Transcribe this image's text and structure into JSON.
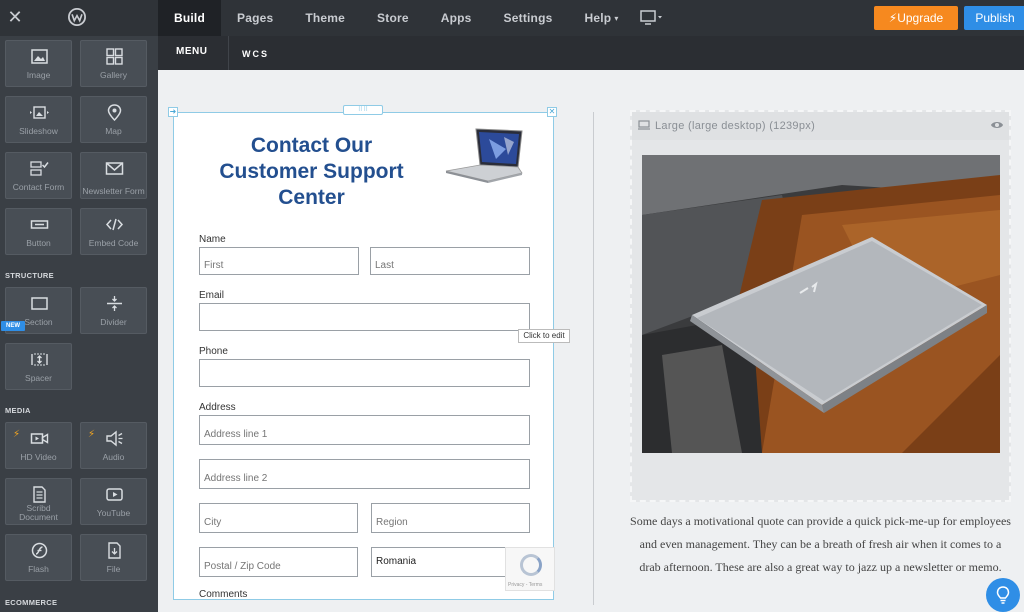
{
  "topbar": {
    "close_icon": "close-icon",
    "logo_icon": "weebly-logo-icon",
    "tabs": [
      "Build",
      "Pages",
      "Theme",
      "Store",
      "Apps",
      "Settings",
      "Help"
    ],
    "active_tab": "Build",
    "help_caret": "▾",
    "device_icon": "monitor-icon",
    "upgrade_label": "Upgrade",
    "publish_label": "Publish",
    "colors": {
      "upgrade": "#f6891f",
      "publish": "#2f8ee6"
    }
  },
  "sidebar": {
    "elements": [
      {
        "label": "Image",
        "icon": "image-icon"
      },
      {
        "label": "Gallery",
        "icon": "gallery-icon"
      },
      {
        "label": "Slideshow",
        "icon": "slideshow-icon"
      },
      {
        "label": "Map",
        "icon": "map-pin-icon"
      },
      {
        "label": "Contact Form",
        "icon": "contact-form-icon"
      },
      {
        "label": "Newsletter Form",
        "icon": "envelope-icon"
      },
      {
        "label": "Button",
        "icon": "button-icon"
      },
      {
        "label": "Embed Code",
        "icon": "code-icon"
      }
    ],
    "structure_title": "STRUCTURE",
    "new_badge": "NEW",
    "structure": [
      {
        "label": "Section",
        "icon": "section-icon"
      },
      {
        "label": "Divider",
        "icon": "divider-icon"
      },
      {
        "label": "Spacer",
        "icon": "spacer-icon"
      }
    ],
    "media_title": "MEDIA",
    "media": [
      {
        "label": "HD Video",
        "icon": "video-icon",
        "premium": true
      },
      {
        "label": "Audio",
        "icon": "audio-icon",
        "premium": true
      },
      {
        "label": "Scribd Document",
        "icon": "document-icon"
      },
      {
        "label": "YouTube",
        "icon": "youtube-icon"
      },
      {
        "label": "Flash",
        "icon": "flash-icon"
      },
      {
        "label": "File",
        "icon": "file-icon"
      }
    ],
    "ecommerce_title": "ECOMMERCE"
  },
  "subnav": {
    "menu_label": "MENU",
    "site_name": "WCS"
  },
  "form": {
    "title": "Contact Our Customer Support Center",
    "fields": {
      "name_label": "Name",
      "first_placeholder": "First",
      "last_placeholder": "Last",
      "email_label": "Email",
      "phone_label": "Phone",
      "address_label": "Address",
      "address1_placeholder": "Address line 1",
      "address2_placeholder": "Address line 2",
      "city_placeholder": "City",
      "region_placeholder": "Region",
      "zip_placeholder": "Postal / Zip Code",
      "country_value": "Romania",
      "comments_label": "Comments"
    },
    "tooltip": "Click to edit",
    "recaptcha_text": "Privacy - Terms"
  },
  "image_block": {
    "header": "Large (large desktop) (1239px)",
    "eye_icon": "eye-icon"
  },
  "body_text": "Some days a motivational quote can provide a quick pick-me-up for employees and even management. They can be a breath of fresh air when it comes to a drab afternoon. These are also a great way to jazz up a newsletter or memo.",
  "help_icon": "lightbulb-icon"
}
